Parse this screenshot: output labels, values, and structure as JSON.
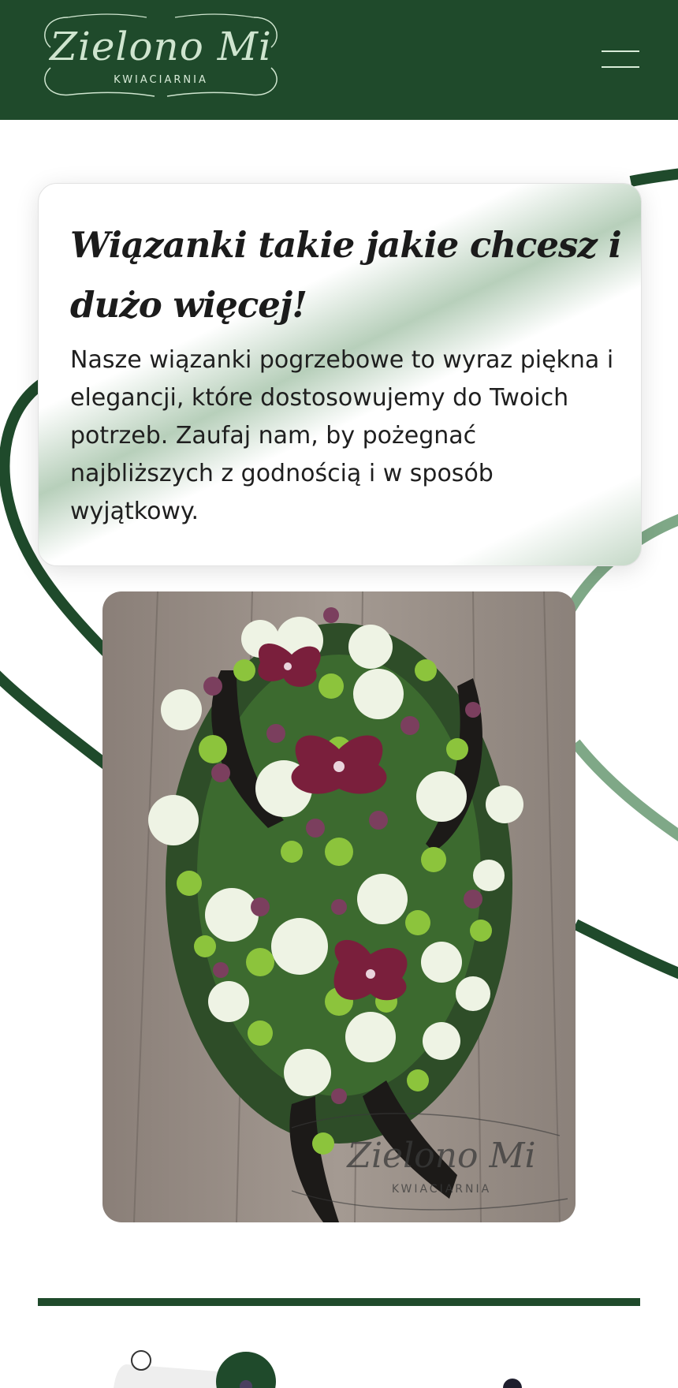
{
  "header": {
    "logo_name": "Zielono Mi",
    "logo_subtitle": "KWIACIARNIA",
    "menu_icon": "hamburger-menu-icon"
  },
  "intro": {
    "title": "Wiązanki takie jakie chcesz i dużo więcej!",
    "text": "Nasze wiązanki pogrzebowe to wyraz piękna i elegancji, które dostosowujemy do Twoich potrzeb. Zaufaj nam, by pożegnać najbliższych z godnością i w sposób wyjątkowy."
  },
  "photo": {
    "watermark_name": "Zielono Mi",
    "watermark_subtitle": "KWIACIARNIA"
  },
  "colors": {
    "brand_dark_green": "#1f4a2b",
    "brand_light_green": "#7fa887",
    "logo_text": "#cfe5cf"
  }
}
